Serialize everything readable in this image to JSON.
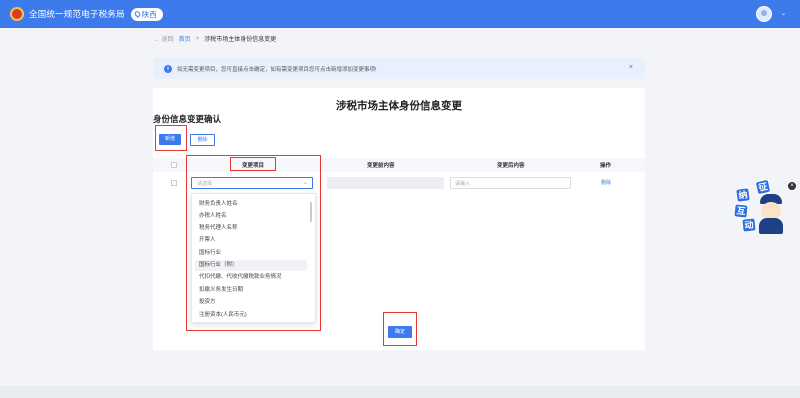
{
  "header": {
    "brand": "全国统一规范电子税务局",
    "region": "陕西",
    "logo_icon": "tax-emblem-icon",
    "user_icon": "user-avatar-icon",
    "caret": "⌄",
    "accent_color": "#3d7bec"
  },
  "breadcrumb": {
    "back": "← 返回",
    "home": "首页",
    "separator": ">",
    "current": "涉税市场主体身份信息变更"
  },
  "alert": {
    "icon": "i",
    "text": "如无需变更项目，您可直接点击确定，如有需变更项目您可点击新增添加变更事项!",
    "close": "×"
  },
  "page": {
    "title": "涉税市场主体身份信息变更",
    "section_title": "身份信息变更确认"
  },
  "toolbar": {
    "add_label": "新增",
    "delete_label": "删除"
  },
  "table": {
    "columns": [
      "变更项目",
      "变更前内容",
      "变更后内容",
      "操作"
    ],
    "row": {
      "select_placeholder": "请选择",
      "select_caret": "⌄",
      "after_placeholder": "请输入",
      "action": "删除"
    }
  },
  "dropdown": {
    "options": [
      "财务负责人姓名",
      "办税人姓名",
      "税务代理人名称",
      "开票人",
      "国标行业",
      "国标行业（附）",
      "代扣代缴、代收代缴税款业务情况",
      "扣缴义务发生日期",
      "投资方",
      "注册资本(人民币元)"
    ],
    "hovered_index": 5
  },
  "footer": {
    "confirm_label": "确定"
  },
  "mascot": {
    "chars": [
      "征",
      "纳",
      "互",
      "动"
    ],
    "close": "×"
  }
}
